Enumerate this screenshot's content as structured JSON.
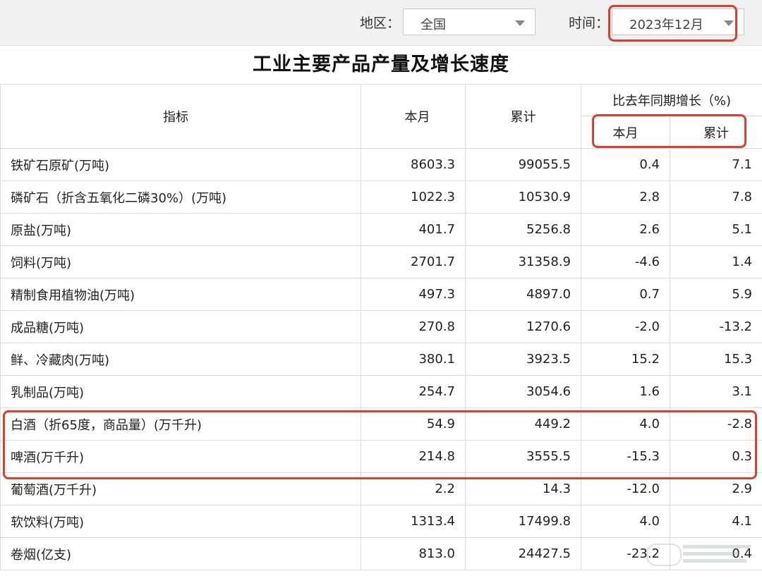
{
  "filters": {
    "region_label": "地区：",
    "region_value": "全国",
    "time_label": "时间：",
    "time_value": "2023年12月"
  },
  "table": {
    "title": "工业主要产品产量及增长速度",
    "headers": {
      "indicator": "指标",
      "this_month": "本月",
      "cumulative": "累计",
      "yoy_group": "比去年同期增长（%)",
      "yoy_this_month": "本月",
      "yoy_cumulative": "累计"
    },
    "rows": [
      {
        "name": "铁矿石原矿(万吨)",
        "month": "8603.3",
        "cum": "99055.5",
        "yoy_month": "0.4",
        "yoy_cum": "7.1"
      },
      {
        "name": "磷矿石（折含五氧化二磷30%）(万吨)",
        "month": "1022.3",
        "cum": "10530.9",
        "yoy_month": "2.8",
        "yoy_cum": "7.8"
      },
      {
        "name": "原盐(万吨)",
        "month": "401.7",
        "cum": "5256.8",
        "yoy_month": "2.6",
        "yoy_cum": "5.1"
      },
      {
        "name": "饲料(万吨)",
        "month": "2701.7",
        "cum": "31358.9",
        "yoy_month": "-4.6",
        "yoy_cum": "1.4"
      },
      {
        "name": "精制食用植物油(万吨)",
        "month": "497.3",
        "cum": "4897.0",
        "yoy_month": "0.7",
        "yoy_cum": "5.9"
      },
      {
        "name": "成品糖(万吨)",
        "month": "270.8",
        "cum": "1270.6",
        "yoy_month": "-2.0",
        "yoy_cum": "-13.2"
      },
      {
        "name": "鲜、冷藏肉(万吨)",
        "month": "380.1",
        "cum": "3923.5",
        "yoy_month": "15.2",
        "yoy_cum": "15.3"
      },
      {
        "name": "乳制品(万吨)",
        "month": "254.7",
        "cum": "3054.6",
        "yoy_month": "1.6",
        "yoy_cum": "3.1"
      },
      {
        "name": "白酒（折65度，商品量）(万千升)",
        "month": "54.9",
        "cum": "449.2",
        "yoy_month": "4.0",
        "yoy_cum": "-2.8"
      },
      {
        "name": "啤酒(万千升)",
        "month": "214.8",
        "cum": "3555.5",
        "yoy_month": "-15.3",
        "yoy_cum": "0.3"
      },
      {
        "name": "葡萄酒(万千升)",
        "month": "2.2",
        "cum": "14.3",
        "yoy_month": "-12.0",
        "yoy_cum": "2.9"
      },
      {
        "name": "软饮料(万吨)",
        "month": "1313.4",
        "cum": "17499.8",
        "yoy_month": "4.0",
        "yoy_cum": "4.1"
      },
      {
        "name": "卷烟(亿支)",
        "month": "813.0",
        "cum": "24427.5",
        "yoy_month": "-23.2",
        "yoy_cum": "0.4"
      }
    ]
  },
  "colors": {
    "highlight": "#d9402d"
  },
  "icons": {
    "dropdown": "chevron-down-icon",
    "watermark": "watermark-logo-icon"
  }
}
